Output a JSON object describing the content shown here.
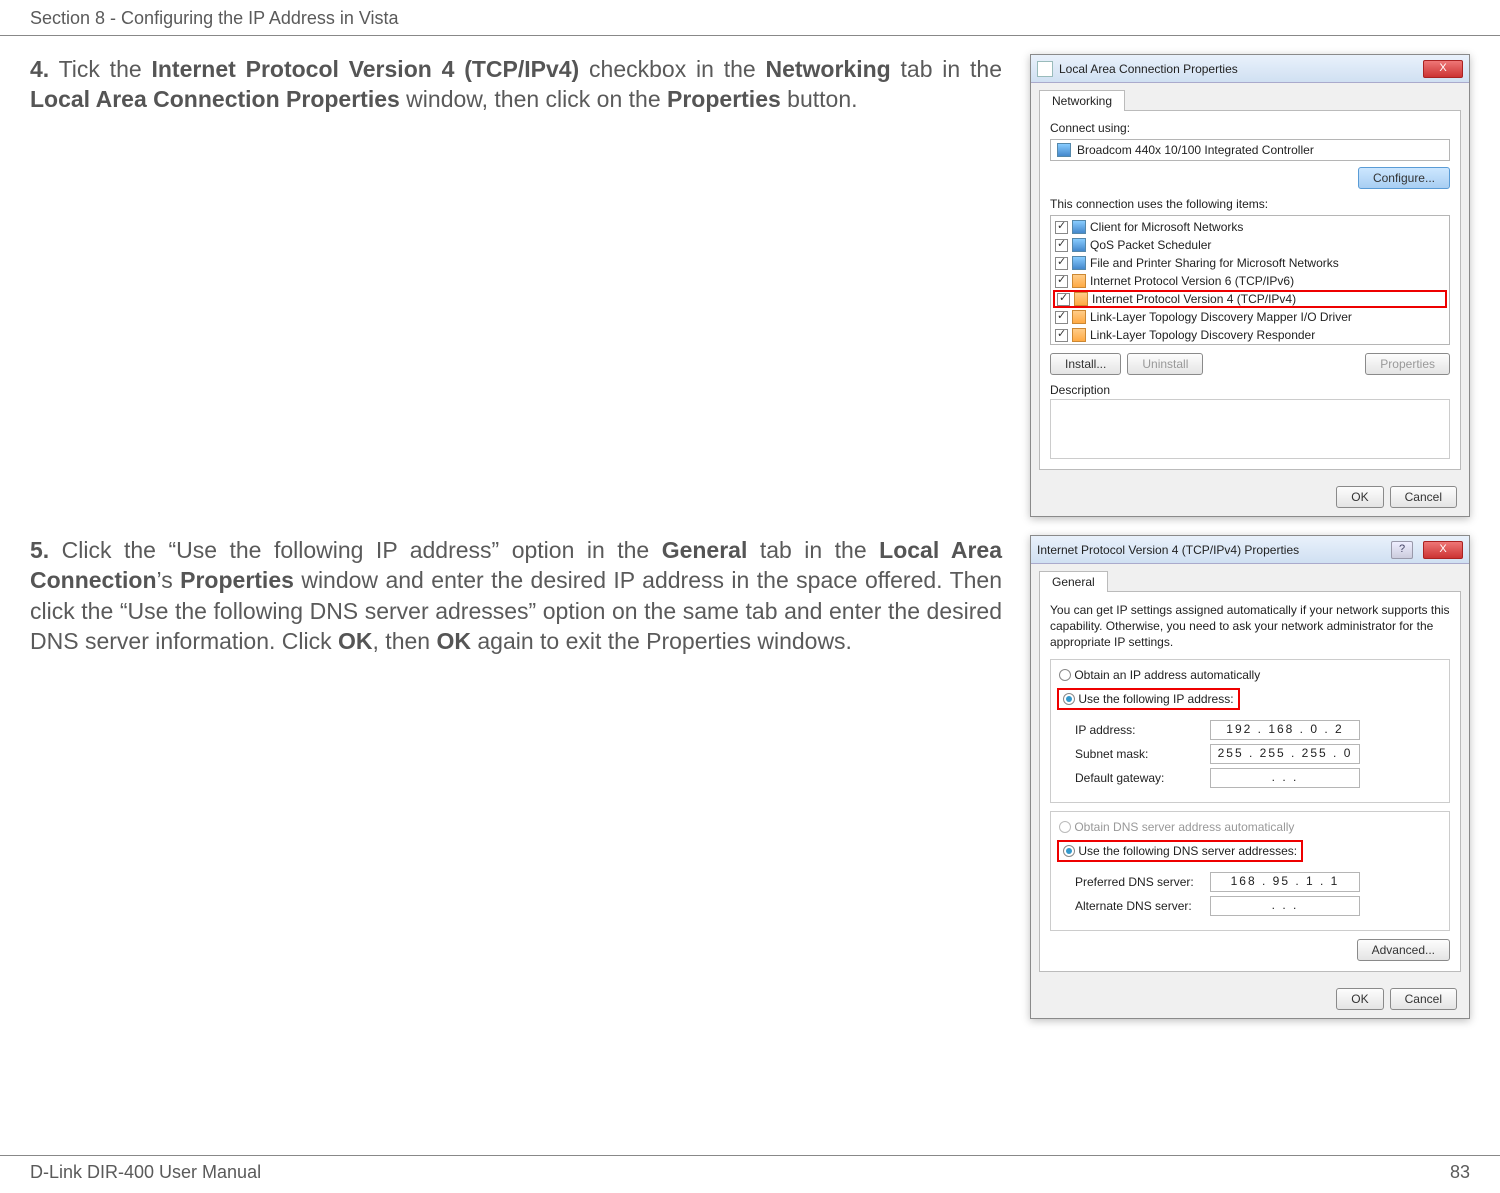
{
  "header": {
    "section_title": "Section 8 - Configuring the IP Address in Vista"
  },
  "steps": {
    "s4": {
      "num": "4.",
      "pre": " Tick the ",
      "b1": "Internet Protocol Version 4 (TCP/IPv4)",
      "mid1": " checkbox in the ",
      "b2": "Networking",
      "mid2": " tab in the ",
      "b3": "Local Area Connection Properties",
      "mid3": " window, then click on the ",
      "b4": "Properties",
      "post": " button."
    },
    "s5": {
      "num": "5.",
      "pre": " Click the “Use the following IP address” option in the ",
      "b1": "General",
      "mid1": " tab in the ",
      "b2": "Local Area Connection",
      "mid2": "’s ",
      "b3": "Properties",
      "mid3": " window and enter the desired IP address in the space offered. Then click the “Use the following DNS server adresses” option on the same tab and enter the desired DNS server information. Click ",
      "b4": "OK",
      "mid4": ", then ",
      "b5": "OK",
      "post": " again to exit the Properties windows."
    }
  },
  "dialog1": {
    "title": "Local Area Connection Properties",
    "close": "X",
    "tab": "Networking",
    "connect_label": "Connect using:",
    "adapter": "Broadcom 440x 10/100 Integrated Controller",
    "configure": "Configure...",
    "items_label": "This connection uses the following items:",
    "items": [
      {
        "label": "Client for Microsoft Networks",
        "ico": "b"
      },
      {
        "label": "QoS Packet Scheduler",
        "ico": "b"
      },
      {
        "label": "File and Printer Sharing for Microsoft Networks",
        "ico": "b"
      },
      {
        "label": "Internet Protocol Version 6 (TCP/IPv6)",
        "ico": "o"
      },
      {
        "label": "Internet Protocol Version 4 (TCP/IPv4)",
        "ico": "o"
      },
      {
        "label": "Link-Layer Topology Discovery Mapper I/O Driver",
        "ico": "o"
      },
      {
        "label": "Link-Layer Topology Discovery Responder",
        "ico": "o"
      }
    ],
    "install": "Install...",
    "uninstall": "Uninstall",
    "properties": "Properties",
    "desc_label": "Description",
    "ok": "OK",
    "cancel": "Cancel"
  },
  "dialog2": {
    "title": "Internet Protocol Version 4 (TCP/IPv4) Properties",
    "help": "?",
    "close": "X",
    "tab": "General",
    "intro": "You can get IP settings assigned automatically if your network supports this capability. Otherwise, you need to ask your network administrator for the appropriate IP settings.",
    "r_auto_ip": "Obtain an IP address automatically",
    "r_use_ip": "Use the following IP address:",
    "ip_label": "IP address:",
    "ip_value": "192 . 168 .   0   .   2",
    "mask_label": "Subnet mask:",
    "mask_value": "255 . 255 . 255 .   0",
    "gw_label": "Default gateway:",
    "gw_value": ".       .       .",
    "r_auto_dns": "Obtain DNS server address automatically",
    "r_use_dns": "Use the following DNS server addresses:",
    "pdns_label": "Preferred DNS server:",
    "pdns_value": "168 .  95  .   1   .   1",
    "adns_label": "Alternate DNS server:",
    "adns_value": ".       .       .",
    "advanced": "Advanced...",
    "ok": "OK",
    "cancel": "Cancel"
  },
  "footer": {
    "left": "D-Link DIR-400 User Manual",
    "right": "83"
  }
}
